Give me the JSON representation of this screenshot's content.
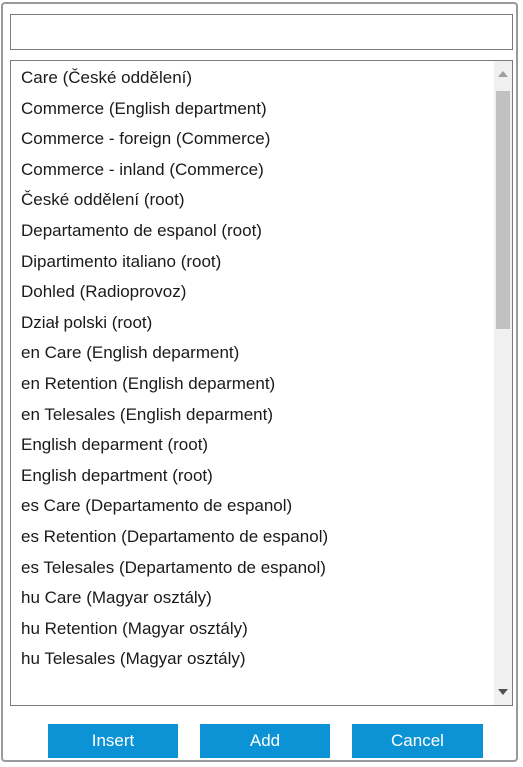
{
  "search": {
    "value": "",
    "placeholder": ""
  },
  "list": {
    "items": [
      "Care (České oddělení)",
      "Commerce (English department)",
      "Commerce - foreign (Commerce)",
      "Commerce - inland (Commerce)",
      "České oddělení (root)",
      "Departamento de espanol (root)",
      "Dipartimento italiano (root)",
      "Dohled (Radioprovoz)",
      "Dział polski (root)",
      "en Care (English deparment)",
      "en Retention (English deparment)",
      "en Telesales (English deparment)",
      "English deparment (root)",
      "English department (root)",
      "es Care (Departamento de espanol)",
      "es Retention (Departamento de espanol)",
      "es Telesales (Departamento de espanol)",
      "hu Care (Magyar osztály)",
      "hu Retention (Magyar osztály)",
      "hu Telesales (Magyar osztály)"
    ]
  },
  "scrollbar": {
    "up_icon": "triangle-up-icon",
    "down_icon": "triangle-down-icon",
    "arrow_color": "#a0a0a0",
    "down_arrow_color": "#505050"
  },
  "buttons": {
    "insert_label": "Insert",
    "add_label": "Add",
    "cancel_label": "Cancel",
    "color": "#0c93d6"
  }
}
